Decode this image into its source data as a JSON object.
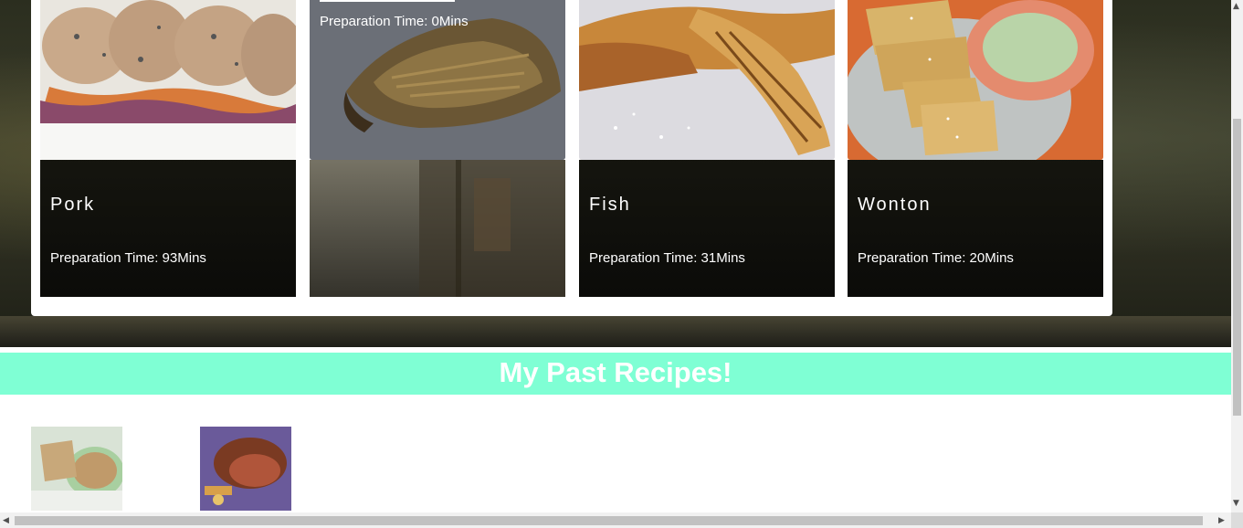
{
  "cards": [
    {
      "title": "Pork",
      "time": "Preparation Time: 93Mins",
      "image_icon": "pork-chops-image"
    },
    {
      "title": "",
      "time": "Preparation Time: 0Mins",
      "image_icon": "casserole-image"
    },
    {
      "title": "Fish",
      "time": "Preparation Time: 31Mins",
      "image_icon": "fried-fish-image"
    },
    {
      "title": "Wonton",
      "time": "Preparation Time: 20Mins",
      "image_icon": "wonton-chips-image"
    }
  ],
  "past_recipes": {
    "heading": "My Past Recipes!",
    "items": [
      {
        "image_icon": "cereal-bowl-image"
      },
      {
        "image_icon": "roast-beef-image"
      }
    ]
  },
  "colors": {
    "section_bar": "#7fffd4",
    "card_panel": "#ffffff",
    "card_text": "#ffffff"
  }
}
